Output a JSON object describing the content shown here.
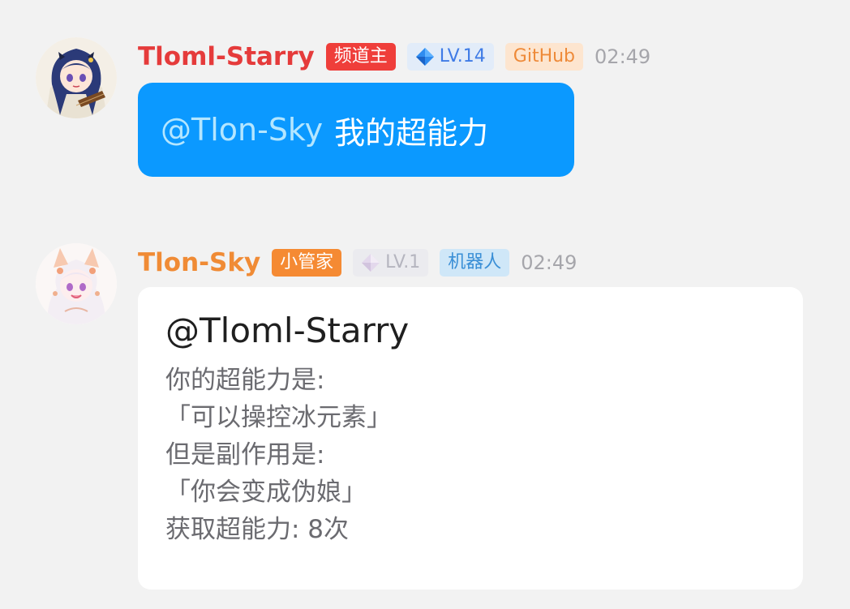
{
  "messages": [
    {
      "sender": "Tloml-Starry",
      "badges": {
        "role": "频道主",
        "level": "LV.14",
        "tag": "GitHub"
      },
      "time": "02:49",
      "mention": "@Tlon-Sky",
      "text": "我的超能力",
      "colors": {
        "name": "#e53b3b",
        "bubble": "#0b99ff"
      }
    },
    {
      "sender": "Tlon-Sky",
      "badges": {
        "role": "小管家",
        "level": "LV.1",
        "tag": "机器人"
      },
      "time": "02:49",
      "mention": "@Tloml-Starry",
      "lines": [
        "你的超能力是:",
        "「可以操控冰元素」",
        "但是副作用是:",
        "「你会变成伪娘」",
        "获取超能力: 8次"
      ],
      "colors": {
        "name": "#f08b35",
        "bubble": "#ffffff"
      }
    }
  ],
  "icons": {
    "level_high": "blue-diamond-icon",
    "level_low": "pale-diamond-icon"
  }
}
